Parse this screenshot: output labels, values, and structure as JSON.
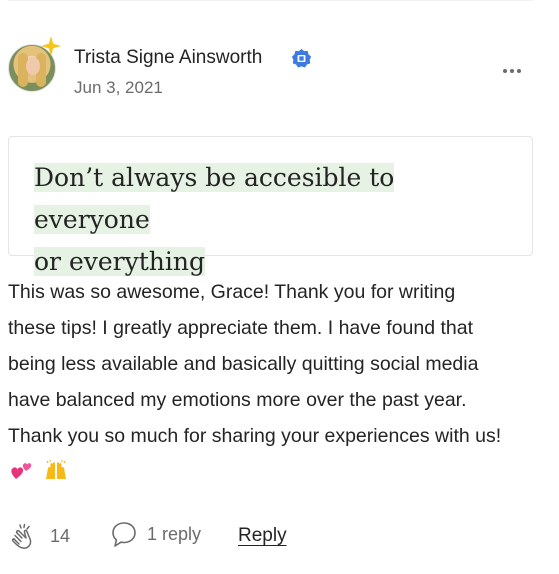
{
  "comment": {
    "author": {
      "name": "Trista Signe Ainsworth",
      "avatar_icon": "author-avatar",
      "badge_icon": "sparkle-icon",
      "verified_icon": "verified-badge-icon",
      "verified_color": "#3d7be2"
    },
    "date": "Jun 3, 2021",
    "more_icon": "more-horizontal-icon",
    "highlight": {
      "text_line1": "Don’t always be accesible to everyone",
      "text_line2": "or everything",
      "highlight_color": "#e6f2e4"
    },
    "body_lines": [
      "This was so awesome, Grace! Thank you for writing",
      "these tips! I greatly appreciate them. I have found that",
      "being less available and basically quitting social media",
      "have balanced my emotions more over the past year.",
      "Thank you so much for sharing your experiences with us!"
    ],
    "emojis": [
      "two-hearts-emoji",
      "raising-hands-emoji"
    ],
    "actions": {
      "clap_icon": "clap-icon",
      "clap_count": "14",
      "reply_icon": "speech-bubble-icon",
      "reply_count_label": "1 reply",
      "reply_label": "Reply"
    }
  }
}
